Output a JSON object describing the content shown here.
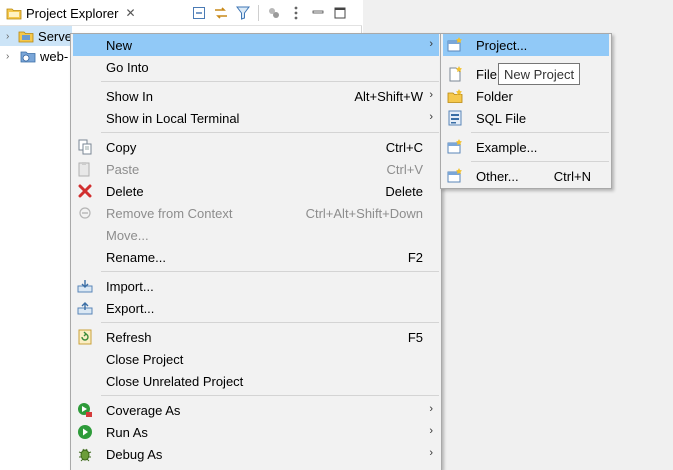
{
  "view": {
    "title": "Project Explorer",
    "close_glyph": "✕",
    "toolbar_icons": [
      "collapse-all-icon",
      "link-with-editor-icon",
      "filter-icon",
      "focus-icon",
      "view-menu-icon",
      "minimize-icon",
      "maximize-icon"
    ]
  },
  "tree": {
    "items": [
      {
        "label": "Serve",
        "twisty": "›",
        "icon": "servers-folder-icon"
      },
      {
        "label": "web-",
        "twisty": "›",
        "icon": "web-project-icon"
      }
    ]
  },
  "context_menu": {
    "items": [
      {
        "label": "New",
        "shortcut": "",
        "submenu": true,
        "icon": ""
      },
      {
        "label": "Go Into",
        "shortcut": "",
        "submenu": false,
        "icon": ""
      },
      {
        "label": "Show In",
        "shortcut": "Alt+Shift+W",
        "submenu": true,
        "icon": ""
      },
      {
        "label": "Show in Local Terminal",
        "shortcut": "",
        "submenu": true,
        "icon": ""
      },
      {
        "label": "Copy",
        "shortcut": "Ctrl+C",
        "submenu": false,
        "icon": "copy-icon"
      },
      {
        "label": "Paste",
        "shortcut": "Ctrl+V",
        "submenu": false,
        "icon": "paste-icon",
        "disabled": true
      },
      {
        "label": "Delete",
        "shortcut": "Delete",
        "submenu": false,
        "icon": "delete-icon"
      },
      {
        "label": "Remove from Context",
        "shortcut": "Ctrl+Alt+Shift+Down",
        "submenu": false,
        "icon": "remove-context-icon",
        "disabled": true
      },
      {
        "label": "Move...",
        "shortcut": "",
        "submenu": false,
        "icon": "",
        "disabled": true
      },
      {
        "label": "Rename...",
        "shortcut": "F2",
        "submenu": false,
        "icon": ""
      },
      {
        "label": "Import...",
        "shortcut": "",
        "submenu": false,
        "icon": "import-icon"
      },
      {
        "label": "Export...",
        "shortcut": "",
        "submenu": false,
        "icon": "export-icon"
      },
      {
        "label": "Refresh",
        "shortcut": "F5",
        "submenu": false,
        "icon": "refresh-icon"
      },
      {
        "label": "Close Project",
        "shortcut": "",
        "submenu": false,
        "icon": ""
      },
      {
        "label": "Close Unrelated Project",
        "shortcut": "",
        "submenu": false,
        "icon": ""
      },
      {
        "label": "Coverage As",
        "shortcut": "",
        "submenu": true,
        "icon": "coverage-icon"
      },
      {
        "label": "Run As",
        "shortcut": "",
        "submenu": true,
        "icon": "run-icon"
      },
      {
        "label": "Debug As",
        "shortcut": "",
        "submenu": true,
        "icon": "debug-icon"
      }
    ],
    "arrow_glyph": "›"
  },
  "submenu": {
    "items": [
      {
        "label": "Project...",
        "shortcut": "",
        "icon": "new-project-icon"
      },
      {
        "label": "File",
        "shortcut": "",
        "icon": "new-file-icon"
      },
      {
        "label": "Folder",
        "shortcut": "",
        "icon": "new-folder-icon"
      },
      {
        "label": "SQL File",
        "shortcut": "",
        "icon": "sql-file-icon"
      },
      {
        "label": "Example...",
        "shortcut": "",
        "icon": "new-example-icon"
      },
      {
        "label": "Other...",
        "shortcut": "Ctrl+N",
        "icon": "new-other-icon"
      }
    ]
  },
  "tooltip": {
    "text": "New Project"
  },
  "colors": {
    "highlight": "#91c9f7",
    "menu_bg": "#f2f2f2",
    "disabled_text": "#8d8d8d"
  }
}
